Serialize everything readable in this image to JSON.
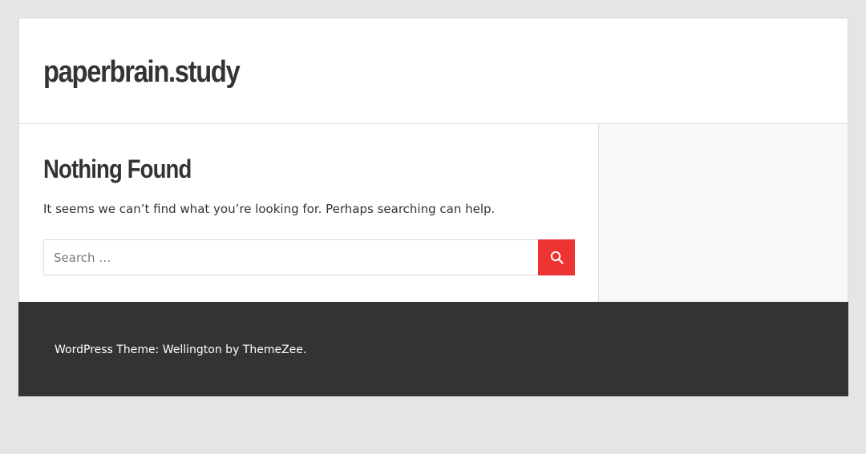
{
  "header": {
    "site_title": "paperbrain.study"
  },
  "main": {
    "title": "Nothing Found",
    "message": "It seems we can’t find what you’re looking for. Perhaps searching can help.",
    "search": {
      "placeholder": "Search …",
      "value": "",
      "button_icon": "search-icon"
    }
  },
  "footer": {
    "credit": "WordPress Theme: Wellington by ThemeZee."
  },
  "colors": {
    "accent": "#ee3333",
    "footer_bg": "#333333",
    "page_bg": "#e5e5e5",
    "sidebar_bg": "#f8f8f8",
    "text": "#333333"
  }
}
